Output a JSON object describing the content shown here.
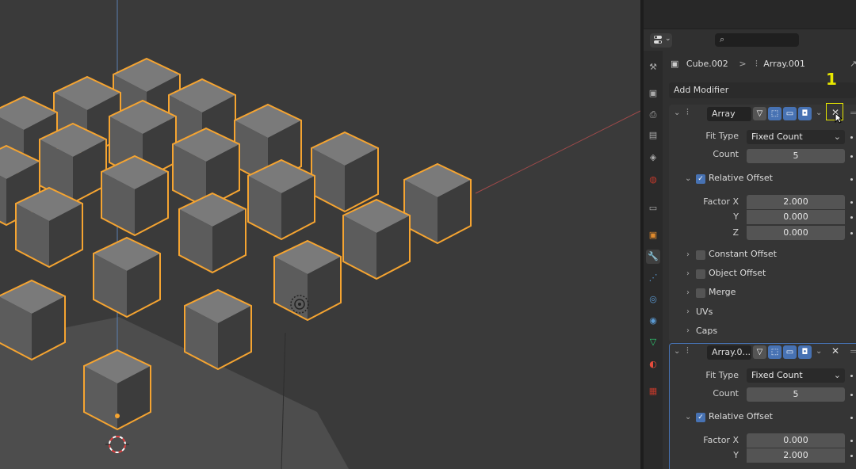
{
  "header": {
    "search_icon": "magnifier-icon",
    "editor_type_icon": "properties-editor-icon"
  },
  "breadcrumb": {
    "object": "Cube.002",
    "separator": ">",
    "modifier": "Array.001"
  },
  "add_modifier_label": "Add Modifier",
  "annotation_label": "1",
  "modifiers": [
    {
      "name": "Array",
      "fit_type_label": "Fit Type",
      "fit_type_value": "Fixed Count",
      "count_label": "Count",
      "count_value": "5",
      "relative_offset_label": "Relative Offset",
      "factor_x_label": "Factor X",
      "factor_x_value": "2.000",
      "y_label": "Y",
      "y_value": "0.000",
      "z_label": "Z",
      "z_value": "0.000",
      "constant_offset_label": "Constant Offset",
      "object_offset_label": "Object Offset",
      "merge_label": "Merge",
      "uvs_label": "UVs",
      "caps_label": "Caps"
    },
    {
      "name": "Array.0...",
      "fit_type_label": "Fit Type",
      "fit_type_value": "Fixed Count",
      "count_label": "Count",
      "count_value": "5",
      "relative_offset_label": "Relative Offset",
      "factor_x_label": "Factor X",
      "factor_x_value": "0.000",
      "y_label": "Y",
      "y_value": "2.000"
    }
  ],
  "colors": {
    "accent": "#4772b3",
    "selection_outline": "#f5a431",
    "highlight_box": "#e8e800"
  }
}
